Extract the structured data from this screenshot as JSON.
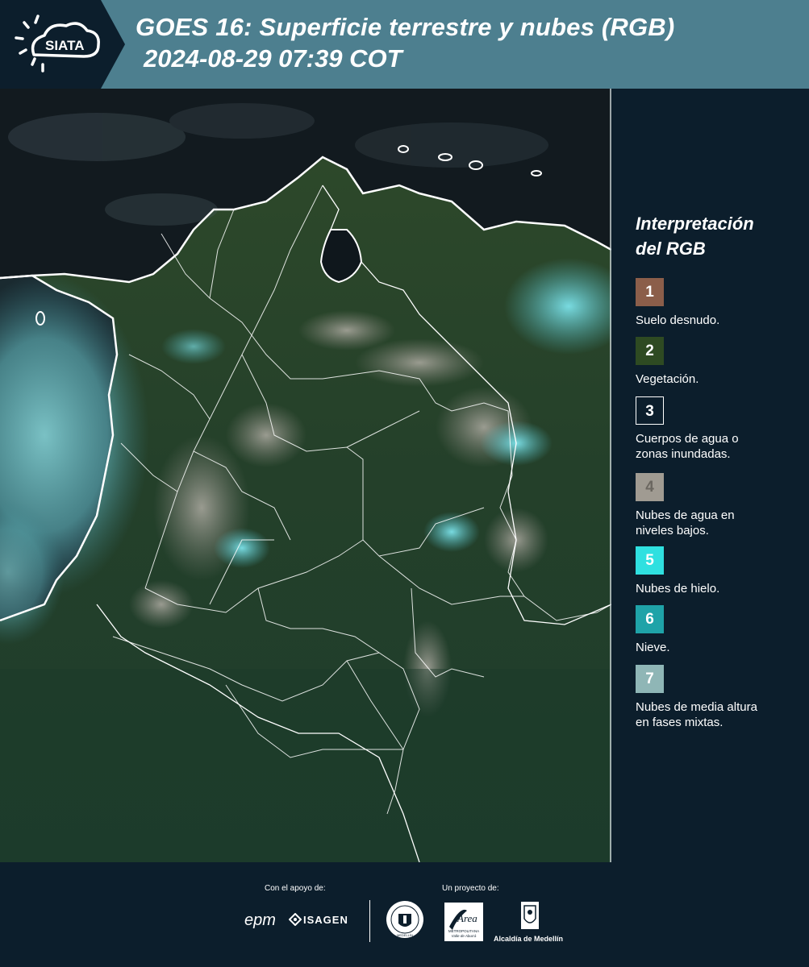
{
  "header": {
    "logo_text": "SIATA",
    "title": "GOES 16: Superficie terrestre y nubes (RGB)",
    "datetime": "2024-08-29 07:39 COT"
  },
  "legend": {
    "title_line1": "Interpretación",
    "title_line2": "del RGB",
    "items": [
      {
        "number": "1",
        "label_line1": "Suelo desnudo.",
        "label_line2": "",
        "color": "#8b5e4a"
      },
      {
        "number": "2",
        "label_line1": "Vegetación.",
        "label_line2": "",
        "color": "#2e4a22"
      },
      {
        "number": "3",
        "label_line1": "Cuerpos de agua o",
        "label_line2": "zonas inundadas.",
        "color": "#0c1e2c"
      },
      {
        "number": "4",
        "label_line1": "Nubes de agua en",
        "label_line2": "niveles bajos.",
        "color": "#a09b92"
      },
      {
        "number": "5",
        "label_line1": "Nubes de hielo.",
        "label_line2": "",
        "color": "#2fe0e0"
      },
      {
        "number": "6",
        "label_line1": "Nieve.",
        "label_line2": "",
        "color": "#1fa3a8"
      },
      {
        "number": "7",
        "label_line1": "Nubes de media altura",
        "label_line2": "en fases mixtas.",
        "color": "#8fb6b6"
      }
    ]
  },
  "footer": {
    "support_caption": "Con el apoyo de:",
    "project_caption": "Un proyecto de:",
    "epm": "epm",
    "isagen": "ISAGEN",
    "area_word": "Área",
    "area_sub1": "METROPOLITANA",
    "area_sub2": "Valle de Aburrá",
    "alcaldia": "Alcaldía de Medellín",
    "seal_text": "MEDELLÍN"
  },
  "colors": {
    "header_bg": "#4d7f8f",
    "logo_bg": "#0c1e2c",
    "page_bg": "#0c1e2c"
  }
}
